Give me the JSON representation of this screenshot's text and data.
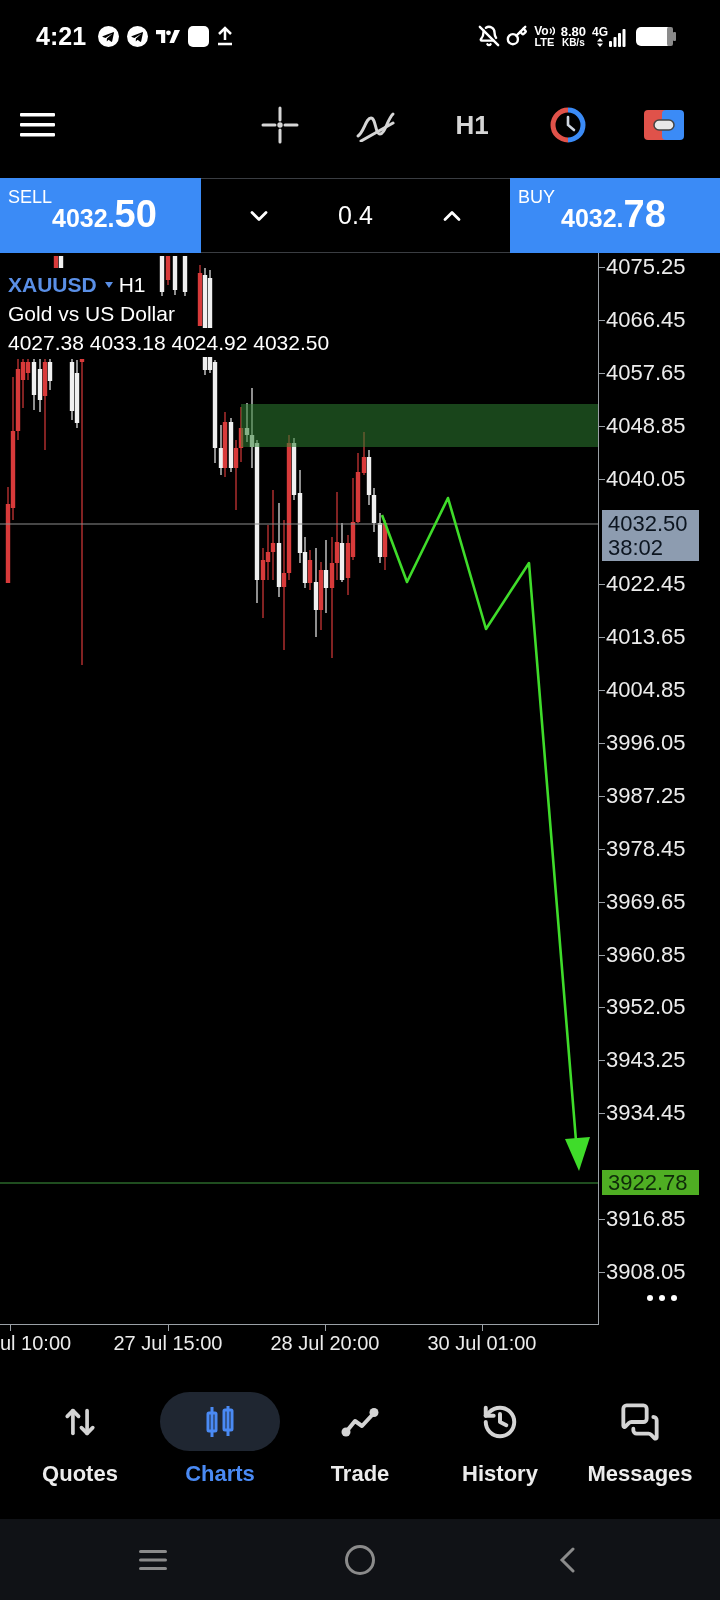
{
  "status_bar": {
    "time": "4:21",
    "volte": {
      "top": "Vo",
      "bottom": "LTE"
    },
    "data_speed": {
      "value": "8.80",
      "unit": "KB/s"
    },
    "network_type": "4G"
  },
  "toolbar": {
    "timeframe": "H1"
  },
  "trade_panel": {
    "sell": {
      "label": "SELL",
      "price": "4032.",
      "price_large": "50"
    },
    "lot_size": "0.4",
    "buy": {
      "label": "BUY",
      "price": "4032.",
      "price_large": "78"
    }
  },
  "chart": {
    "symbol": "XAUUSD",
    "timeframe": "H1",
    "description": "Gold vs US Dollar",
    "ohlc": "4027.38 4033.18 4024.92 4032.50",
    "price_axis": [
      {
        "kind": "label",
        "text": "4075.25"
      },
      {
        "kind": "label",
        "text": "4066.45"
      },
      {
        "kind": "label",
        "text": "4057.65"
      },
      {
        "kind": "label",
        "text": "4048.85"
      },
      {
        "kind": "label",
        "text": "4040.05"
      },
      {
        "kind": "current_tag",
        "price": "4032.50",
        "countdown": "38:02"
      },
      {
        "kind": "label",
        "text": "4022.45"
      },
      {
        "kind": "label",
        "text": "4013.65"
      },
      {
        "kind": "label",
        "text": "4004.85"
      },
      {
        "kind": "label",
        "text": "3996.05"
      },
      {
        "kind": "label",
        "text": "3987.25"
      },
      {
        "kind": "label",
        "text": "3978.45"
      },
      {
        "kind": "label",
        "text": "3969.65"
      },
      {
        "kind": "label",
        "text": "3960.85"
      },
      {
        "kind": "label",
        "text": "3952.05"
      },
      {
        "kind": "label",
        "text": "3943.25"
      },
      {
        "kind": "label",
        "text": "3934.45"
      },
      {
        "kind": "target_tag",
        "price": "3922.78"
      },
      {
        "kind": "label",
        "text": "3916.85"
      },
      {
        "kind": "label",
        "text": "3908.05"
      }
    ],
    "time_labels": [
      "ul 10:00",
      "27 Jul 15:00",
      "28 Jul 20:00",
      "30 Jul 01:00"
    ]
  },
  "bottom_nav": [
    {
      "label": "Quotes",
      "selected": false
    },
    {
      "label": "Charts",
      "selected": true
    },
    {
      "label": "Trade",
      "selected": false
    },
    {
      "label": "History",
      "selected": false
    },
    {
      "label": "Messages",
      "selected": false
    }
  ]
}
